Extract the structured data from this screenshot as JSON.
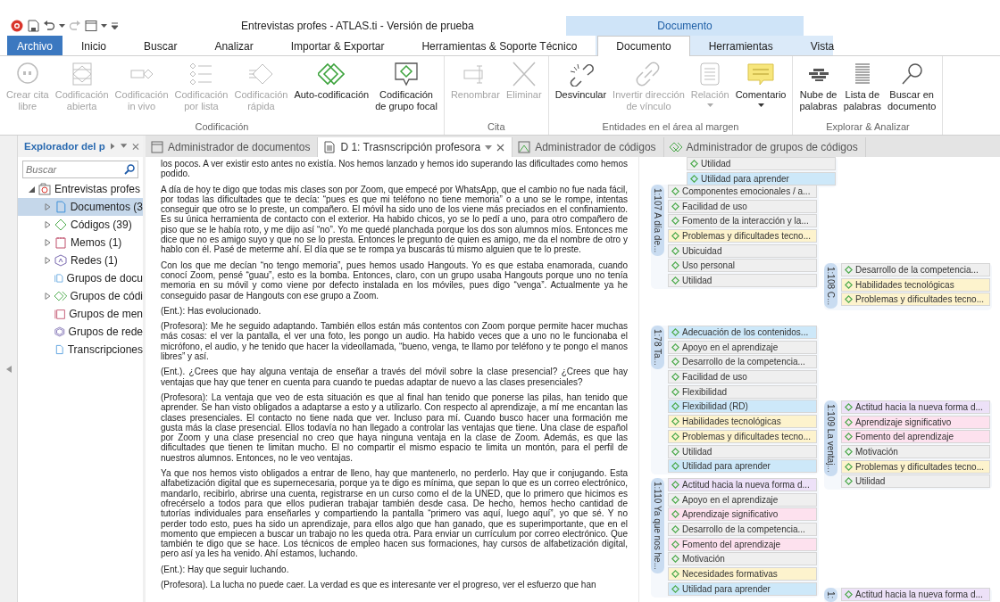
{
  "window": {
    "title": "Entrevistas profes - ATLAS.ti - Versión de prueba"
  },
  "context_tab_group": {
    "label": "Documento"
  },
  "ribbon_tabs": [
    {
      "label": "Archivo",
      "kind": "file",
      "selected": false
    },
    {
      "label": "Inicio",
      "kind": "main",
      "selected": false
    },
    {
      "label": "Buscar",
      "kind": "main",
      "selected": false
    },
    {
      "label": "Analizar",
      "kind": "main",
      "selected": false
    },
    {
      "label": "Importar & Exportar",
      "kind": "main",
      "selected": false
    },
    {
      "label": "Herramientas & Soporte Técnico",
      "kind": "main",
      "selected": false
    },
    {
      "label": "Documento",
      "kind": "context",
      "selected": true
    },
    {
      "label": "Herramientas",
      "kind": "context",
      "selected": false
    },
    {
      "label": "Vista",
      "kind": "context",
      "selected": false
    }
  ],
  "ribbon_groups": [
    {
      "label": "Codificación",
      "buttons": [
        {
          "label": "Crear cita\nlibre",
          "disabled": true,
          "dropdown": false
        },
        {
          "label": "Codificación\nabierta",
          "disabled": true,
          "dropdown": false
        },
        {
          "label": "Codificación\nin vivo",
          "disabled": true,
          "dropdown": false
        },
        {
          "label": "Codificación\npor lista",
          "disabled": true,
          "dropdown": false
        },
        {
          "label": "Codificación\nrápida",
          "disabled": true,
          "dropdown": false
        },
        {
          "label": "Auto-codificación",
          "disabled": false,
          "dropdown": false
        },
        {
          "label": "Codificación\nde grupo focal",
          "disabled": false,
          "dropdown": false
        }
      ]
    },
    {
      "label": "Cita",
      "buttons": [
        {
          "label": "Renombrar",
          "disabled": true,
          "dropdown": false
        },
        {
          "label": "Eliminar",
          "disabled": true,
          "dropdown": false
        }
      ]
    },
    {
      "label": "Entidades en el área al margen",
      "buttons": [
        {
          "label": "Desvincular",
          "disabled": false,
          "dropdown": false
        },
        {
          "label": "Invertir dirección\nde vínculo",
          "disabled": true,
          "dropdown": false
        },
        {
          "label": "Relación",
          "disabled": true,
          "dropdown": true
        },
        {
          "label": "Comentario",
          "disabled": false,
          "dropdown": true
        }
      ]
    },
    {
      "label": "Explorar & Analizar",
      "buttons": [
        {
          "label": "Nube de\npalabras",
          "disabled": false,
          "dropdown": false
        },
        {
          "label": "Lista de\npalabras",
          "disabled": false,
          "dropdown": false
        },
        {
          "label": "Buscar en\ndocumento",
          "disabled": false,
          "dropdown": false
        }
      ]
    }
  ],
  "sidebar": {
    "title": "Explorador del p",
    "search": {
      "placeholder": "Buscar"
    },
    "tree": [
      {
        "label": "Entrevistas profes",
        "expanded": true,
        "selected": false,
        "children": [
          {
            "label": "Documentos (3",
            "expanded": false,
            "selected": true
          },
          {
            "label": "Códigos (39)",
            "expanded": false,
            "selected": false
          },
          {
            "label": "Memos (1)",
            "expanded": false,
            "selected": false
          },
          {
            "label": "Redes (1)",
            "expanded": false,
            "selected": false
          },
          {
            "label": "Grupos de docu",
            "selected": false
          },
          {
            "label": "Grupos de códi",
            "expanded": false,
            "selected": false
          },
          {
            "label": "Grupos de men",
            "selected": false
          },
          {
            "label": "Grupos de rede",
            "selected": false
          },
          {
            "label": "Transcripciones",
            "selected": false
          }
        ]
      }
    ]
  },
  "document_tabs": [
    {
      "label": "Administrador de documentos",
      "selected": false,
      "closable": false
    },
    {
      "label": "D 1: Trasnscripción profesora",
      "selected": true,
      "closable": true
    },
    {
      "label": "Administrador de códigos",
      "selected": false,
      "closable": false
    },
    {
      "label": "Administrador de grupos de códigos",
      "selected": false,
      "closable": false
    }
  ],
  "document": {
    "paragraphs": [
      "los pocos. A ver existir esto antes no existía. Nos hemos lanzado y hemos ido superando las dificultades como hemos podido.",
      "A día de hoy te digo que todas mis clases son por Zoom, que empecé por WhatsApp, que el cambio no fue nada fácil, por todas las dificultades que te decía: “pues es que mi teléfono no tiene memoria” o a uno se le rompe, intentas conseguir que otro se lo preste, un compañero. El móvil ha sido uno de los viene más preciados en el confinamiento. Es su única herramienta de contacto con el exterior. Ha habido chicos, yo se lo pedí a uno, para otro compañero de piso que se le había roto, y me dijo así “no”. Yo me quedé planchada porque los dos son alumnos míos. Entonces me dice que no es amigo suyo y que no se lo presta. Entonces le pregunto de quien es amigo, me da el nombre de otro y hablo con él. Pasé de meterme ahí. El día que se te rompa ya buscarás tú mismo alguien que te lo preste.",
      "Con los que me decían “no tengo memoria”, pues hemos usado Hangouts. Yo es que estaba enamorada, cuando conocí Zoom, pensé “guau”, esto es la bomba. Entonces, claro, con un grupo usaba Hangouts porque uno no tenía memoria en su móvil y como viene por defecto instalada en los móviles, pues digo “venga”. Actualmente ya he conseguido pasar de Hangouts con ese grupo a Zoom.",
      "(Ent.): Has evolucionado.",
      "(Profesora): Me he seguido adaptando. También ellos están más contentos con Zoom porque permite hacer muchas más cosas: el ver la pantalla, el ver una foto, les pongo un audio. Ha habido veces que a uno no le funcionaba el micrófono, el audio, y he tenido que hacer la videollamada, “bueno, venga, te llamo por teléfono y te pongo el manos libres” y así.",
      "(Ent.). ¿Crees que hay alguna ventaja de enseñar a través del móvil sobre la clase presencial? ¿Crees que hay ventajas que hay que tener en cuenta para cuando te puedas adaptar de nuevo a las clases presenciales?",
      "(Profesora): La ventaja que veo de esta situación es que al final han tenido que ponerse las pilas, han tenido que aprender. Se han visto obligados a adaptarse a esto y a utilizarlo. Con respecto al aprendizaje, a mí me encantan las clases presenciales. El contacto no tiene nada que ver. Incluso para mí. Cuando busco hacer una formación me gusta más la clase presencial. Ellos todavía no han llegado a controlar las ventajas que tiene. Una clase de español por Zoom y una clase presencial no creo que haya ninguna ventaja en la clase de Zoom. Además, es que las dificultades que tienen te limitan mucho. El no compartir el mismo espacio te limita un montón, para el perfil de nuestros alumnos. Entonces, no le veo ventajas.",
      "Ya que nos hemos visto obligados a entrar de lleno, hay que mantenerlo, no perderlo. Hay que ir conjugando. Esta alfabetización digital que es supernecesaria, porque ya te digo es mínima, que sepan lo que es un correo electrónico, mandarlo, recibirlo, abrirse una cuenta, registrarse en un curso como el de la UNED, que lo primero que hicimos es ofrecérselo a todos para que ellos pudieran trabajar también desde casa. De hecho, hemos hecho cantidad de tutorías individuales para enseñarles y compartiendo la pantalla “primero vas aquí, luego aquí”, yo que sé. Y no perder todo esto, pues ha sido un aprendizaje, para ellos algo que han ganado, que es superimportante, que en el momento que empiecen a buscar un trabajo no les queda otra. Para enviar un currículum por correo electrónico. Que también te digo que se hace. Los técnicos de empleo hacen sus formaciones, hay cursos de alfabetización digital, pero así ya les ha venido. Ahí estamos, luchando.",
      "(Ent.): Hay que seguir luchando.",
      "(Profesora). La lucha no puede caer. La verdad es que es interesante ver el progreso, ver el esfuerzo que han"
    ]
  },
  "margin": {
    "groups": [
      {
        "codes": [
          {
            "label": "Utilidad",
            "color": "#efefef"
          },
          {
            "label": "Utilidad para aprender",
            "color": "#cde8f9"
          }
        ]
      },
      {
        "label": "1:107 A día de...",
        "codes": [
          {
            "label": "Componentes emocionales / a...",
            "color": "#efefef"
          },
          {
            "label": "Facilidad de uso",
            "color": "#efefef"
          },
          {
            "label": "Fomento de la interacción y la...",
            "color": "#efefef"
          },
          {
            "label": "Problemas y dificultades tecno...",
            "color": "#fdf3cd"
          },
          {
            "label": "Ubicuidad",
            "color": "#efefef"
          },
          {
            "label": "Uso personal",
            "color": "#efefef"
          },
          {
            "label": "Utilidad",
            "color": "#efefef"
          }
        ]
      },
      {
        "label": "1:108 C...",
        "codes": [
          {
            "label": "Desarrollo de la competencia...",
            "color": "#efefef"
          },
          {
            "label": "Habilidades tecnológicas",
            "color": "#fdf3cd"
          },
          {
            "label": "Problemas y dificultades tecno...",
            "color": "#fdf3cd"
          }
        ]
      },
      {
        "label": "1:78 Ta...",
        "codes": [
          {
            "label": "Adecuación de los contenidos...",
            "color": "#cde8f9"
          },
          {
            "label": "Apoyo en el aprendizaje",
            "color": "#efefef"
          },
          {
            "label": "Desarrollo de la competencia...",
            "color": "#efefef"
          },
          {
            "label": "Facilidad de uso",
            "color": "#efefef"
          },
          {
            "label": "Flexibilidad",
            "color": "#efefef"
          },
          {
            "label": "Flexibilidad (RD)",
            "color": "#cde8f9"
          },
          {
            "label": "Habilidades tecnológicas",
            "color": "#fdf3cd"
          },
          {
            "label": "Problemas y dificultades tecno...",
            "color": "#fdf3cd"
          },
          {
            "label": "Utilidad",
            "color": "#efefef"
          },
          {
            "label": "Utilidad para aprender",
            "color": "#cde8f9"
          }
        ]
      },
      {
        "label": "1:109 La ventaj...",
        "codes": [
          {
            "label": "Actitud hacia la nueva forma d...",
            "color": "#ede1f8"
          },
          {
            "label": "Aprendizaje significativo",
            "color": "#fde1ee"
          },
          {
            "label": "Fomento del aprendizaje",
            "color": "#fde1ee"
          },
          {
            "label": "Motivación",
            "color": "#efefef"
          },
          {
            "label": "Problemas y dificultades tecno...",
            "color": "#fdf3cd"
          },
          {
            "label": "Utilidad",
            "color": "#efefef"
          }
        ]
      },
      {
        "label": "1:110 Ya que nos he...",
        "codes": [
          {
            "label": "Actitud hacia la nueva forma d...",
            "color": "#ede1f8"
          },
          {
            "label": "Apoyo en el aprendizaje",
            "color": "#efefef"
          },
          {
            "label": "Aprendizaje significativo",
            "color": "#fde1ee"
          },
          {
            "label": "Desarrollo de la competencia...",
            "color": "#efefef"
          },
          {
            "label": "Fomento del aprendizaje",
            "color": "#fde1ee"
          },
          {
            "label": "Motivación",
            "color": "#efefef"
          },
          {
            "label": "Necesidades formativas",
            "color": "#fdf3cd"
          },
          {
            "label": "Utilidad para aprender",
            "color": "#cde8f9"
          }
        ]
      },
      {
        "label": "1:",
        "codes": [
          {
            "label": "Actitud hacia la nueva forma d...",
            "color": "#ede1f8"
          }
        ]
      }
    ]
  }
}
